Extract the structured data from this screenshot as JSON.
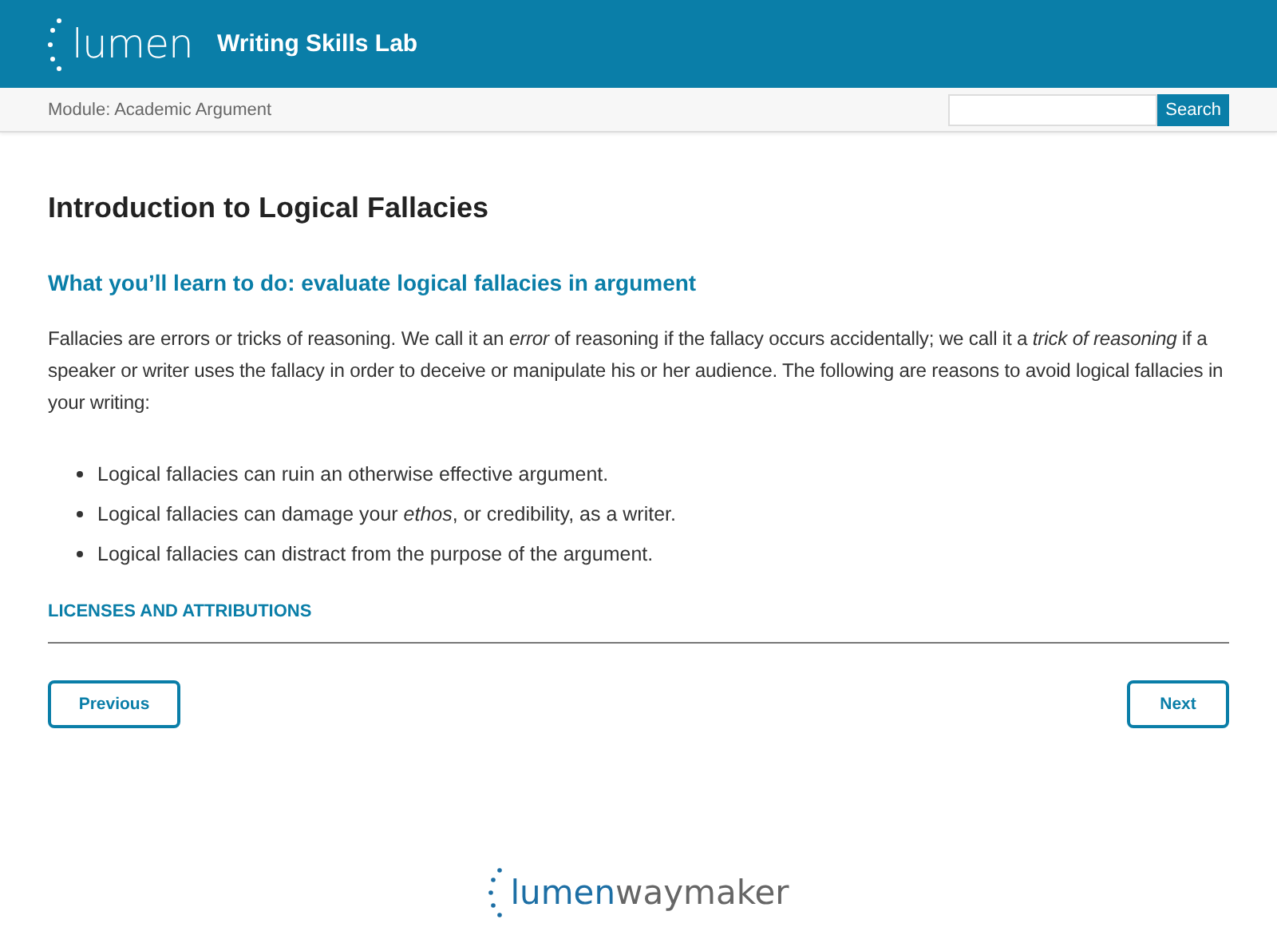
{
  "header": {
    "logo": "lumen",
    "title": "Writing Skills Lab"
  },
  "subbar": {
    "module": "Module: Academic Argument",
    "search": {
      "button": "Search"
    }
  },
  "page": {
    "title": "Introduction to Logical Fallacies",
    "subtitle": "What you’ll learn to do: evaluate logical fallacies in argument",
    "intro": "Fallacies are errors or tricks of reasoning. We call it an *error* of reasoning if the fallacy occurs accidentally; we call it a *trick of reasoning* if a speaker or writer uses the fallacy in order to deceive or manipulate his or her audience. The following are reasons to avoid logical fallacies in your writing:",
    "bullets": [
      "Logical fallacies can ruin an otherwise effective argument.",
      "Logical fallacies can damage your *ethos*, or credibility, as a writer.",
      "Logical fallacies can distract from the purpose of the argument."
    ],
    "licenses": "LICENSES AND ATTRIBUTIONS"
  },
  "nav": {
    "previous": "Previous",
    "next": "Next"
  },
  "footer": {
    "brand": "lumen",
    "product": "waymaker"
  }
}
